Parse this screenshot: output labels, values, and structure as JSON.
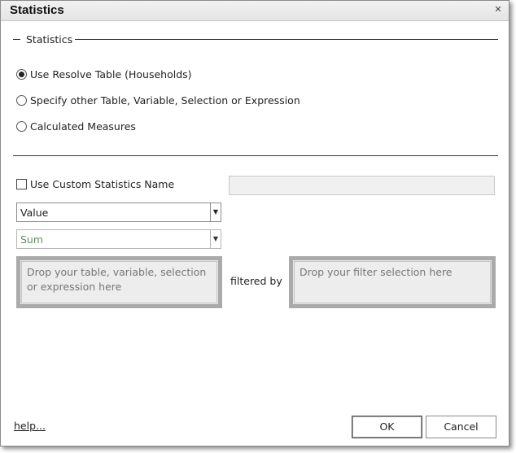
{
  "window": {
    "title": "Statistics"
  },
  "group": {
    "label": "Statistics"
  },
  "options": [
    {
      "label": "Use Resolve Table (Households)",
      "selected": true
    },
    {
      "label": "Specify other Table, Variable, Selection or Expression",
      "selected": false
    },
    {
      "label": "Calculated Measures",
      "selected": false
    }
  ],
  "custom_name": {
    "label": "Use Custom Statistics Name",
    "checked": false,
    "value": ""
  },
  "value_combo": {
    "selected": "Value"
  },
  "aggregate_combo": {
    "selected": "Sum"
  },
  "source_drop": {
    "placeholder": "Drop your table, variable, selection or expression here"
  },
  "filtered_by": "filtered by",
  "filter_drop": {
    "placeholder": "Drop your filter selection here"
  },
  "footer": {
    "help": "help...",
    "ok": "OK",
    "cancel": "Cancel"
  },
  "icons": {
    "close": "close-icon",
    "dropdown": "chevron-down-icon"
  }
}
